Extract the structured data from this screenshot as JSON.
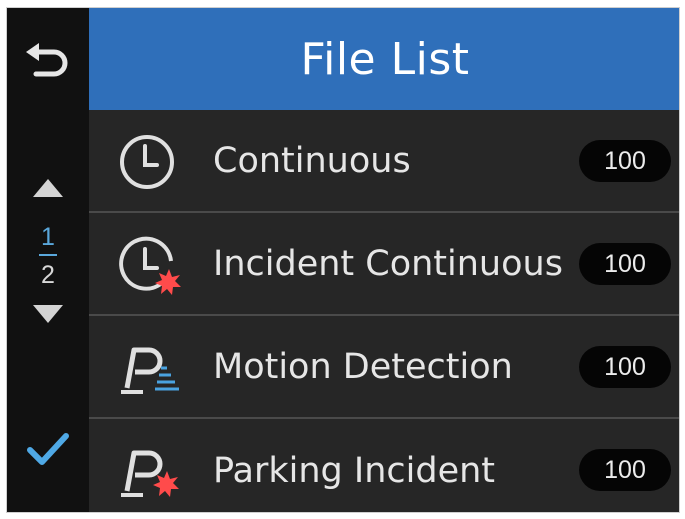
{
  "header": {
    "title": "File List"
  },
  "pagination": {
    "current": "1",
    "total": "2"
  },
  "items": [
    {
      "label": "Continuous",
      "count": "100",
      "icon": "clock-icon"
    },
    {
      "label": "Incident Continuous",
      "count": "100",
      "icon": "clock-incident-icon"
    },
    {
      "label": "Motion Detection",
      "count": "100",
      "icon": "parking-motion-icon"
    },
    {
      "label": "Parking Incident",
      "count": "100",
      "icon": "parking-incident-icon"
    }
  ],
  "colors": {
    "header_bg": "#2f6fba",
    "accent": "#5aa8dc",
    "incident": "#ff4b4b",
    "row_bg": "#262626"
  }
}
